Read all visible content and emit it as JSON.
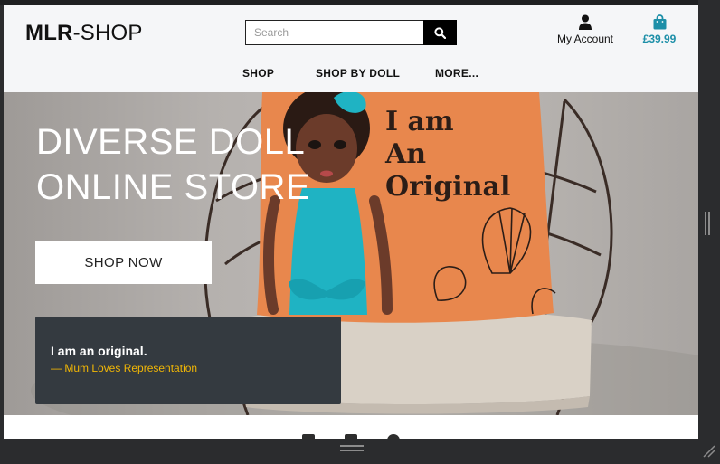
{
  "header": {
    "logo_bold": "MLR",
    "logo_rest": "-SHOP",
    "search_placeholder": "Search",
    "account_label": "My Account",
    "cart_total": "£39.99"
  },
  "nav": {
    "items": [
      "SHOP",
      "SHOP BY DOLL",
      "MORE..."
    ]
  },
  "hero": {
    "title_line1": "DIVERSE DOLL",
    "title_line2": "ONLINE STORE",
    "cta_label": "SHOP NOW",
    "pillow_text_1": "I am",
    "pillow_text_2": "An",
    "pillow_text_3": "Original"
  },
  "quote": {
    "text": "I am an original.",
    "author": "— Mum Loves Representation"
  },
  "colors": {
    "accent": "#1d8fa8",
    "quote_bg": "#343a40",
    "quote_author": "#f2b705",
    "header_bg": "#f5f6f8",
    "pillow": "#e8874d"
  },
  "icons": [
    "search-icon",
    "user-icon",
    "shopping-bag-icon"
  ]
}
